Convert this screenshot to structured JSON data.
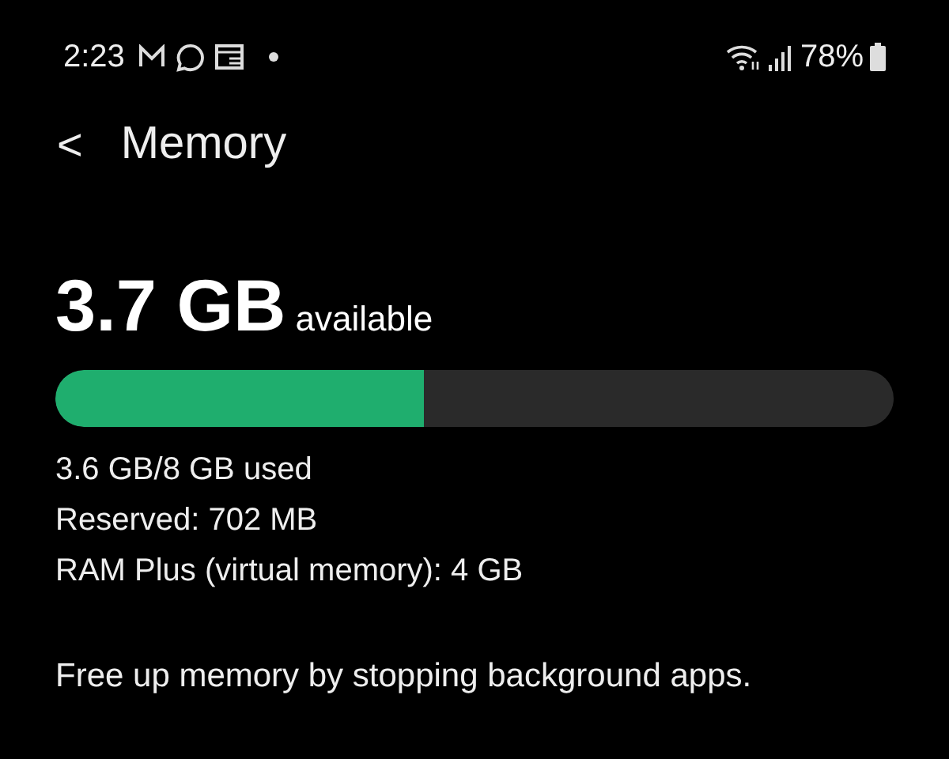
{
  "status_bar": {
    "time": "2:23",
    "battery": "78%"
  },
  "header": {
    "back": "<",
    "title": "Memory"
  },
  "memory": {
    "amount": "3.7 GB",
    "unit_label": "available",
    "level": 0.44,
    "details": [
      "3.6 GB/8 GB used",
      "Reserved: 702 MB",
      "RAM Plus (virtual memory): 4 GB"
    ],
    "action": "Free up memory by stopping background apps."
  }
}
